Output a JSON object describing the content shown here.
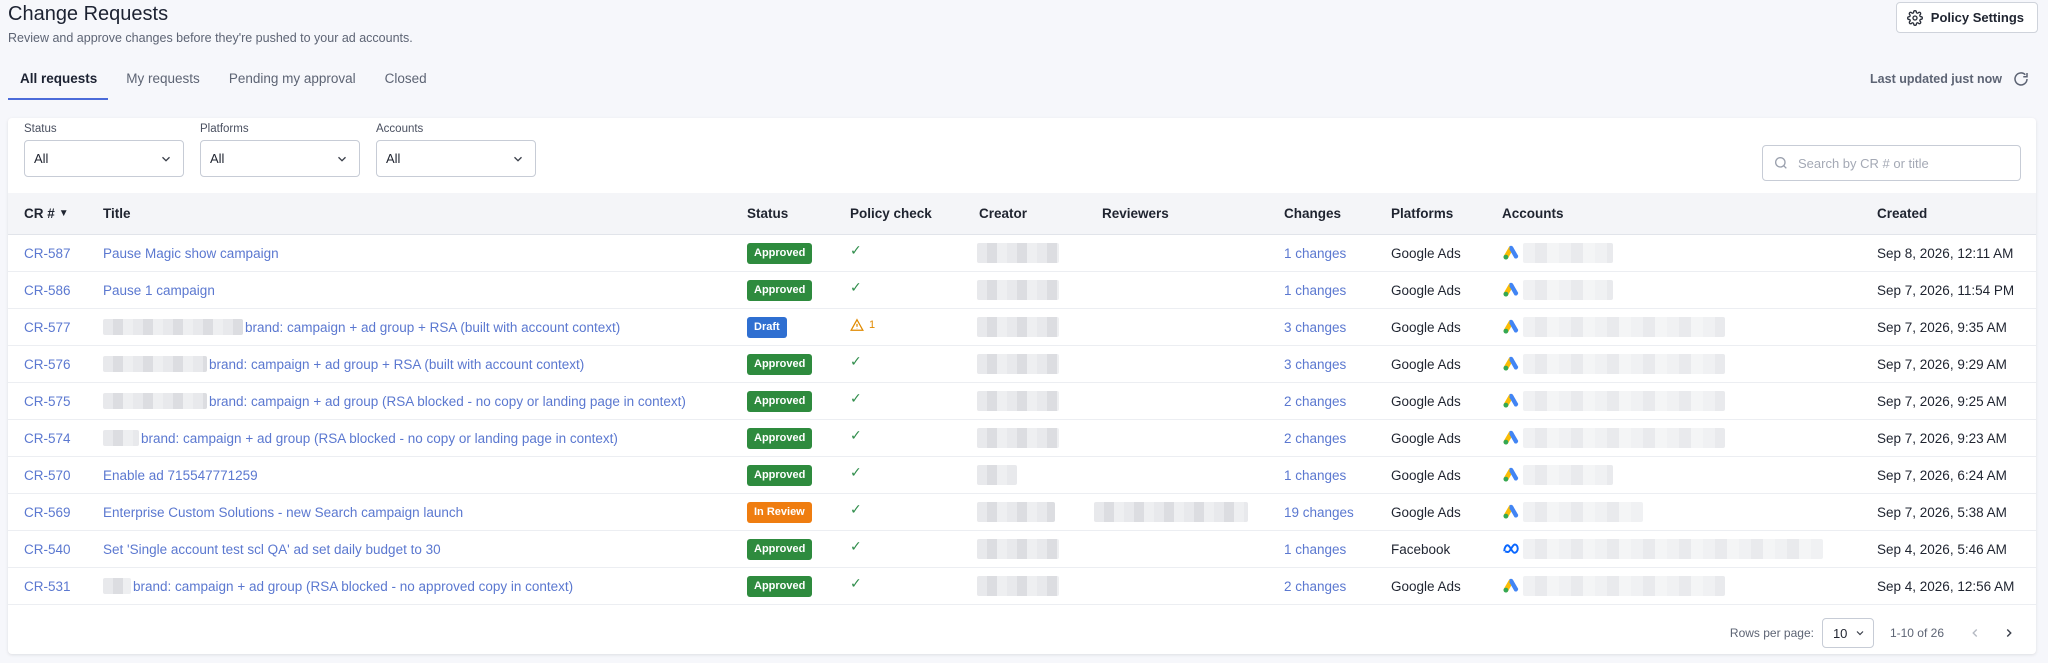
{
  "header": {
    "title": "Change Requests",
    "subtitle": "Review and approve changes before they're pushed to your ad accounts.",
    "policy_button": "Policy Settings"
  },
  "tabs": [
    "All requests",
    "My requests",
    "Pending my approval",
    "Closed"
  ],
  "last_updated": "Last updated just now",
  "filters": {
    "status": {
      "label": "Status",
      "value": "All"
    },
    "platforms": {
      "label": "Platforms",
      "value": "All"
    },
    "accounts": {
      "label": "Accounts",
      "value": "All"
    }
  },
  "search": {
    "placeholder": "Search by CR # or title"
  },
  "columns": {
    "cr": "CR #",
    "sort_indicator": "▼",
    "title": "Title",
    "status": "Status",
    "policy": "Policy check",
    "creator": "Creator",
    "reviewers": "Reviewers",
    "changes": "Changes",
    "platforms": "Platforms",
    "accounts": "Accounts",
    "created": "Created"
  },
  "rows": [
    {
      "cr": "CR-587",
      "title": "Pause Magic show campaign",
      "status": "Approved",
      "policy": "check",
      "changes": "1 changes",
      "platform": "Google Ads",
      "created": "Sep 8, 2026, 12:11 AM"
    },
    {
      "cr": "CR-586",
      "title": "Pause 1 campaign",
      "status": "Approved",
      "policy": "check",
      "changes": "1 changes",
      "platform": "Google Ads",
      "created": "Sep 7, 2026, 11:54 PM"
    },
    {
      "cr": "CR-577",
      "title": "brand: campaign + ad group + RSA (built with account context)",
      "status": "Draft",
      "policy": "warning",
      "policy_count": "1",
      "changes": "3 changes",
      "platform": "Google Ads",
      "created": "Sep 7, 2026, 9:35 AM"
    },
    {
      "cr": "CR-576",
      "title": "brand: campaign + ad group + RSA (built with account context)",
      "status": "Approved",
      "policy": "check",
      "changes": "3 changes",
      "platform": "Google Ads",
      "created": "Sep 7, 2026, 9:29 AM"
    },
    {
      "cr": "CR-575",
      "title": "brand: campaign + ad group (RSA blocked - no copy or landing page in context)",
      "status": "Approved",
      "policy": "check",
      "changes": "2 changes",
      "platform": "Google Ads",
      "created": "Sep 7, 2026, 9:25 AM"
    },
    {
      "cr": "CR-574",
      "title": "brand: campaign + ad group (RSA blocked - no copy or landing page in context)",
      "status": "Approved",
      "policy": "check",
      "changes": "2 changes",
      "platform": "Google Ads",
      "created": "Sep 7, 2026, 9:23 AM"
    },
    {
      "cr": "CR-570",
      "title": "Enable ad 715547771259",
      "status": "Approved",
      "policy": "check",
      "changes": "1 changes",
      "platform": "Google Ads",
      "created": "Sep 7, 2026, 6:24 AM"
    },
    {
      "cr": "CR-569",
      "title": "Enterprise Custom Solutions - new Search campaign launch",
      "status": "In Review",
      "policy": "check",
      "changes": "19 changes",
      "platform": "Google Ads",
      "created": "Sep 7, 2026, 5:38 AM"
    },
    {
      "cr": "CR-540",
      "title": "Set 'Single account test scl QA' ad set daily budget to 30",
      "status": "Approved",
      "policy": "check",
      "changes": "1 changes",
      "platform": "Facebook",
      "created": "Sep 4, 2026, 5:46 AM"
    },
    {
      "cr": "CR-531",
      "title": "brand: campaign + ad group (RSA blocked - no approved copy in context)",
      "status": "Approved",
      "policy": "check",
      "changes": "2 changes",
      "platform": "Google Ads",
      "created": "Sep 4, 2026, 12:56 AM"
    }
  ],
  "status_colors": {
    "Approved": "#2e8b3e",
    "Draft": "#2f6fd1",
    "In Review": "#ef7d10"
  },
  "accent_color": "#4b6bd9",
  "pagination": {
    "rows_label": "Rows per page:",
    "rows_value": "10",
    "range": "1-10 of 26"
  }
}
